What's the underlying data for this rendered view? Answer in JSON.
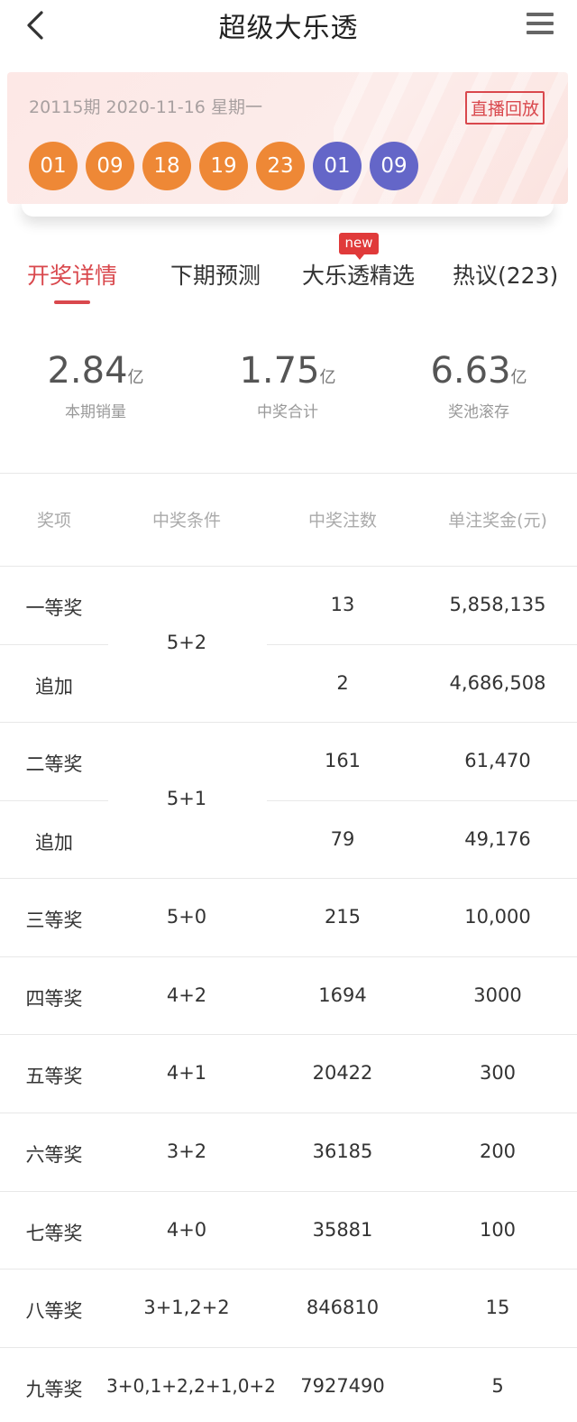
{
  "header": {
    "title": "超级大乐透",
    "back_icon": "back-arrow-icon",
    "menu_icon": "menu-icon"
  },
  "draw": {
    "issue": "20115期 2020-11-16 星期一",
    "replay_label": "直播回放",
    "red_balls": [
      "01",
      "09",
      "18",
      "19",
      "23"
    ],
    "blue_balls": [
      "01",
      "09"
    ],
    "colors": {
      "red_ball": "#ee8836",
      "blue_ball": "#6466c8",
      "accent": "#d9484d"
    }
  },
  "tabs": [
    {
      "label": "开奖详情",
      "active": true
    },
    {
      "label": "下期预测"
    },
    {
      "label": "大乐透精选",
      "badge": "new"
    },
    {
      "label": "热议(223)"
    }
  ],
  "stats": [
    {
      "value": "2.84",
      "unit": "亿",
      "label": "本期销量"
    },
    {
      "value": "1.75",
      "unit": "亿",
      "label": "中奖合计"
    },
    {
      "value": "6.63",
      "unit": "亿",
      "label": "奖池滚存"
    }
  ],
  "table": {
    "headers": [
      "奖项",
      "中奖条件",
      "中奖注数",
      "单注奖金(元)"
    ],
    "rows": [
      {
        "name": "一等奖",
        "count": "13",
        "prize": "5,858,135"
      },
      {
        "name": "追加",
        "count": "2",
        "prize": "4,686,508"
      },
      {
        "name": "二等奖",
        "count": "161",
        "prize": "61,470"
      },
      {
        "name": "追加",
        "count": "79",
        "prize": "49,176"
      },
      {
        "name": "三等奖",
        "condition": "5+0",
        "count": "215",
        "prize": "10,000"
      },
      {
        "name": "四等奖",
        "condition": "4+2",
        "count": "1694",
        "prize": "3000"
      },
      {
        "name": "五等奖",
        "condition": "4+1",
        "count": "20422",
        "prize": "300"
      },
      {
        "name": "六等奖",
        "condition": "3+2",
        "count": "36185",
        "prize": "200"
      },
      {
        "name": "七等奖",
        "condition": "4+0",
        "count": "35881",
        "prize": "100"
      },
      {
        "name": "八等奖",
        "condition": "3+1,2+2",
        "count": "846810",
        "prize": "15"
      },
      {
        "name": "九等奖",
        "condition": "3+0,1+2,2+1,0+2",
        "count": "7927490",
        "prize": "5"
      }
    ],
    "merged_conditions": [
      "5+2",
      "5+1"
    ]
  }
}
